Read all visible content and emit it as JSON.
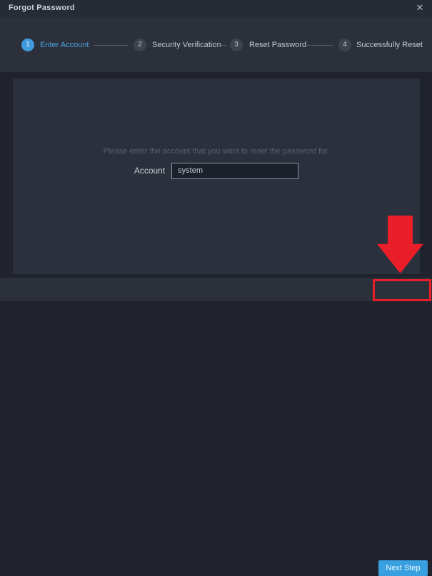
{
  "window": {
    "title": "Forgot Password",
    "close_icon": "✕"
  },
  "steps": [
    {
      "number": "1",
      "label": "Enter Account",
      "active": true
    },
    {
      "number": "2",
      "label": "Security Verification",
      "active": false
    },
    {
      "number": "3",
      "label": "Reset Password",
      "active": false
    },
    {
      "number": "4",
      "label": "Successfully Reset",
      "active": false
    }
  ],
  "content": {
    "instruction": "Please enter the account that you want to reset the password for.",
    "account_label": "Account",
    "account_value": "system"
  },
  "footer": {
    "next_button_label": "Next Step"
  },
  "annotation": {
    "arrow_icon": "red-down-arrow",
    "highlight_color": "#e91e29"
  },
  "colors": {
    "accent_blue": "#3f9bdb",
    "active_label_blue": "#4da5e4",
    "panel_bg": "#2b313c",
    "bar_bg": "#2b303a",
    "window_bg": "#20232c",
    "input_border": "#9096a0",
    "highlight_red": "#e91e29"
  }
}
